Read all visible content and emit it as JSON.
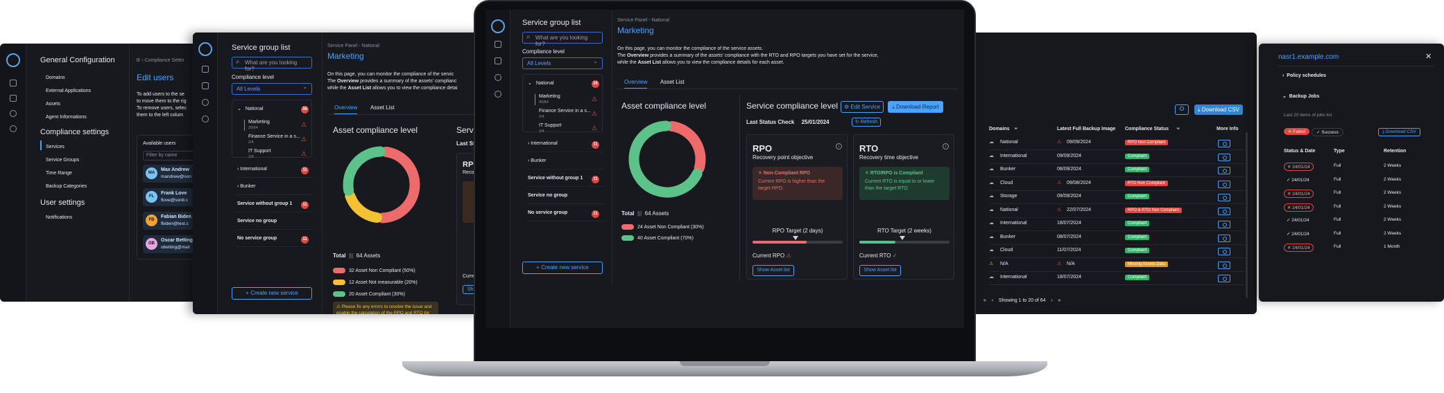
{
  "config_panel": {
    "title": "General Configuration",
    "general_items": [
      "Domains",
      "External Applications",
      "Assets",
      "Agent Informations"
    ],
    "compliance_title": "Compliance settings",
    "compliance_items": [
      "Services",
      "Service Groups",
      "Time Range",
      "Backup Categories"
    ],
    "user_title": "User settings",
    "user_items": [
      "Notifications"
    ],
    "breadcrumb": "Compliance Settin",
    "edit_users_title": "Edit users",
    "edit_users_line1": "To add users to the se",
    "edit_users_line2": "to move them to the rig",
    "edit_users_line3": "To remove users, selec",
    "edit_users_line4": "them to the left colum",
    "available_users_label": "Available users",
    "filter_placeholder": "Filter by name",
    "users": [
      {
        "initials": "MA",
        "name": "Max Andrew",
        "email": "mandrew@son",
        "color": "#7cc3f5"
      },
      {
        "initials": "FL",
        "name": "Frank Love",
        "email": "flove@sonit.c",
        "color": "#7cc3f5"
      },
      {
        "initials": "FB",
        "name": "Fabian Biden",
        "email": "fbiden@test.c",
        "color": "#f0a23b"
      },
      {
        "initials": "OB",
        "name": "Oscar Betting",
        "email": "obetting@mail",
        "color": "#e7a6e0"
      }
    ]
  },
  "service_list_left": {
    "title": "Service group list",
    "search_placeholder": "What are you looking for?",
    "compliance_label": "Compliance level",
    "select_value": "All Levels",
    "national_label": "National",
    "national_count": "36",
    "children": [
      {
        "name": "Marketing",
        "sub": "20/64"
      },
      {
        "name": "Finance Service in a s...",
        "sub": "2/4"
      },
      {
        "name": "IT Support",
        "sub": "2/4"
      }
    ],
    "groups": [
      {
        "name": "International",
        "count": "11"
      },
      {
        "name": "Bunker",
        "count": ""
      },
      {
        "name": "Service without group 1",
        "count": "11"
      },
      {
        "name": "Service no group",
        "count": ""
      },
      {
        "name": "No service group",
        "count": "11"
      }
    ],
    "create_button": "Create new service",
    "panel_label": "Service Panel - National",
    "panel_title": "Marketing",
    "intro_line1": "On this page, you can monitor the compliance of the servic",
    "intro_line2_a": "The ",
    "intro_overview": "Overview",
    "intro_line2_b": " provides a summary of the assets' complianc",
    "intro_line3_a": "while the ",
    "intro_asset_list": "Asset List",
    "intro_line3_b": " allows you to view the compliance detai",
    "tab_overview": "Overview",
    "tab_asset_list": "Asset List",
    "asset_title": "Asset compliance level",
    "total_label": "Total",
    "total_assets": "64 Assets",
    "legend": [
      {
        "label": "32 Asset Non Compliant (50%)",
        "color": "#ee6b6b"
      },
      {
        "label": "12 Asset Not measurable (20%)",
        "color": "#f2c230"
      },
      {
        "label": "20 Asset Compliant (30%)",
        "color": "#5cc28a"
      }
    ],
    "warning_text": "Please fix any errors to resolve the issue and enable the calculation of the RPO and RTO for this service.",
    "service_title_cut": "Servi",
    "last_status_cut": "Last Sta",
    "rpo_cut": "RPO",
    "recov_cut": "Recov",
    "current_cut": "Curren",
    "show_cut": "Sho"
  },
  "laptop": {
    "title": "Service group list",
    "search_placeholder": "What are you looking for?",
    "compliance_label": "Compliance level",
    "select_value": "All Levels",
    "national_label": "National",
    "national_count": "36",
    "children": [
      {
        "name": "Marketing",
        "sub": "40/64"
      },
      {
        "name": "Finance Service in a s...",
        "sub": "2/4"
      },
      {
        "name": "IT Support",
        "sub": "2/4"
      }
    ],
    "groups": [
      {
        "name": "International",
        "count": "11"
      },
      {
        "name": "Bunker",
        "count": ""
      },
      {
        "name": "Service without group 1",
        "count": "11"
      },
      {
        "name": "Service no group",
        "count": ""
      },
      {
        "name": "No service group",
        "count": "11"
      }
    ],
    "create_button": "Create new service",
    "panel_label": "Service Panel - National",
    "panel_title": "Marketing",
    "intro_line1": "On this page, you can monitor the compliance of the service assets.",
    "intro_line2_a": "The ",
    "intro_overview": "Overview",
    "intro_line2_b": " provides a summary of the assets' compliance with the RTO and RPO targets you have set for the service,",
    "intro_line3_a": "while the ",
    "intro_asset_list": "Asset List",
    "intro_line3_b": " allows you to view the compliance details for each asset.",
    "tab_overview": "Overview",
    "tab_asset_list": "Asset List",
    "asset_title": "Asset compliance level",
    "total_label": "Total",
    "total_assets": "64 Assets",
    "legend": [
      {
        "label": "24 Asset Non Compliant (30%)",
        "color": "#ee6b6b"
      },
      {
        "label": "40 Asset Compliant (70%)",
        "color": "#5cc28a"
      }
    ],
    "service_title": "Service compliance level",
    "edit_service": "Edit Service",
    "download_report": "Download Report",
    "last_status_label": "Last Status Check",
    "last_status_date": "25/01/2024",
    "refresh": "Refresh",
    "rpo": {
      "title": "RPO",
      "subtitle": "Recovery point objective",
      "status_title": "Non-Compliant RPO",
      "status_text": "Current RPO is higher than the target RPO.",
      "target": "RPO Target (2 days)",
      "current": "Current RPO",
      "show": "Show Asset list",
      "fill": 0.6
    },
    "rto": {
      "title": "RTO",
      "subtitle": "Recovery time objective",
      "status_title": "RTO/RPO is Compliant",
      "status_text": "Current RTO is equal to or lower than the target RTO.",
      "target": "RTO Target (2 weeks)",
      "current": "Current RTO",
      "show": "Show Asset list",
      "fill": 0.4
    }
  },
  "table_panel": {
    "download_csv": "Download CSV",
    "headers": [
      "Domains",
      "Latest Full Backup Image",
      "Compliance Status",
      "More Info"
    ],
    "rows": [
      {
        "domain": "National",
        "warn": true,
        "date": "09/09/2024",
        "status": "RPO Non Compliant",
        "kind": "red"
      },
      {
        "domain": "International",
        "warn": false,
        "date": "09/09/2024",
        "status": "Compliant",
        "kind": "green"
      },
      {
        "domain": "Bunker",
        "warn": false,
        "date": "08/09/2024",
        "status": "Compliant",
        "kind": "green"
      },
      {
        "domain": "Cloud",
        "warn": true,
        "date": "09/08/2024",
        "status": "RTO Non Compliant",
        "kind": "red"
      },
      {
        "domain": "Storage",
        "warn": false,
        "date": "09/09/2024",
        "status": "Compliant",
        "kind": "green"
      },
      {
        "domain": "National",
        "warn": true,
        "date": "22/07/2024",
        "status": "RPO & RTO Non Compliant",
        "kind": "red"
      },
      {
        "domain": "International",
        "warn": false,
        "date": "18/07/2024",
        "status": "Compliant",
        "kind": "green"
      },
      {
        "domain": "Bunker",
        "warn": false,
        "date": "08/07/2024",
        "status": "Compliant",
        "kind": "green"
      },
      {
        "domain": "Cloud",
        "warn": false,
        "date": "11/07/2024",
        "status": "Compliant",
        "kind": "green"
      },
      {
        "domain": "N/A",
        "warn": true,
        "date": "N/A",
        "status": "Missing Assets Data",
        "kind": "orange"
      },
      {
        "domain": "International",
        "warn": false,
        "date": "18/07/2024",
        "status": "Compliant",
        "kind": "green"
      }
    ],
    "pagination": "Showing 1 to 20 of 64"
  },
  "host_panel": {
    "host": "nasr1.example.com",
    "policy_schedules": "Policy schedules",
    "backup_jobs": "Backup Jobs",
    "jobs_note": "Last 20 items of jobs list",
    "filter_failed": "Failed",
    "filter_success": "Success",
    "download_csv": "Download CSV",
    "headers": [
      "Status & Date",
      "Type",
      "Retention"
    ],
    "rows": [
      {
        "date": "24/01/24",
        "ok": false,
        "type": "Full",
        "retention": "2 Weeks"
      },
      {
        "date": "24/01/24",
        "ok": true,
        "type": "Full",
        "retention": "2 Weeks"
      },
      {
        "date": "24/01/24",
        "ok": false,
        "type": "Full",
        "retention": "2 Weeks"
      },
      {
        "date": "24/01/24",
        "ok": false,
        "type": "Full",
        "retention": "2 Weeks"
      },
      {
        "date": "24/01/24",
        "ok": true,
        "type": "Full",
        "retention": "2 Weeks"
      },
      {
        "date": "24/01/24",
        "ok": true,
        "type": "Full",
        "retention": "2 Weeks"
      },
      {
        "date": "24/01/24",
        "ok": false,
        "type": "Full",
        "retention": "1 Month"
      }
    ]
  }
}
